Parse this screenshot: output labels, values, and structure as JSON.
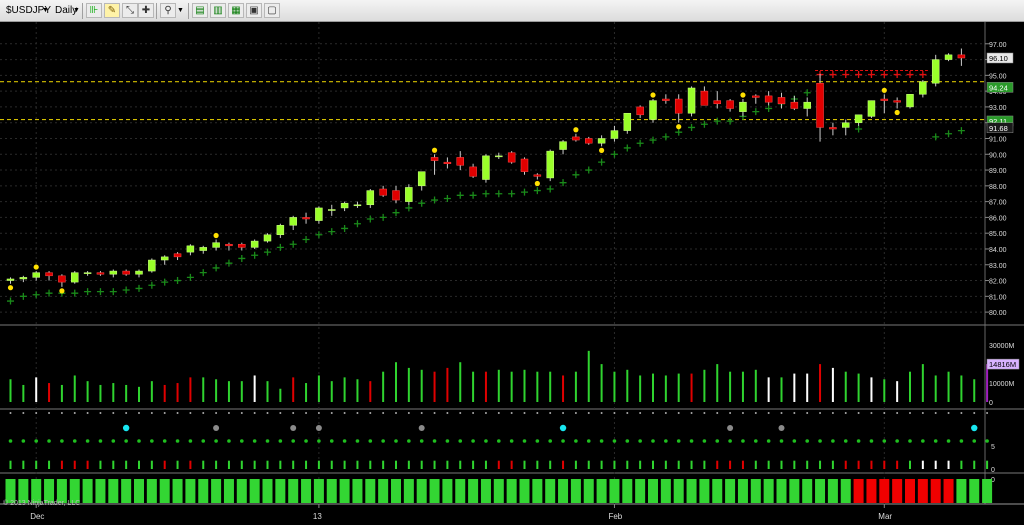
{
  "toolbar": {
    "instrument": "$USDJPY",
    "period": "Daily",
    "icons": [
      "bar-style-icon",
      "draw-pencil-icon",
      "draw-tools-icon",
      "crosshair-icon",
      "zoom-icon",
      "properties-icon",
      "indicators-icon",
      "strategies-icon",
      "templates-icon",
      "data-box-icon"
    ]
  },
  "copyright": "© 2013 NinjaTrader, LLC",
  "colors": {
    "up": "#9aff2a",
    "down": "#e00000",
    "dots": "#00a000",
    "resistance": "#d4c000",
    "last_price": "#e8e8e8",
    "support_label": "#00cc00"
  },
  "chart_data": [
    {
      "type": "candlestick",
      "name": "price",
      "ylim": [
        79.5,
        98
      ],
      "y_ticks": [
        "97.00",
        "96.00",
        "95.00",
        "94.00",
        "93.00",
        "92.00",
        "91.00",
        "90.00",
        "89.00",
        "88.00",
        "87.00",
        "86.00",
        "85.00",
        "84.00",
        "83.00",
        "82.00",
        "81.00",
        "80.00"
      ],
      "x_labels": [
        "Dec",
        "13",
        "Feb",
        "Mar"
      ],
      "x_label_index": [
        2,
        24,
        47,
        68
      ],
      "price_labels": {
        "last": "96.10",
        "upper": "94.24",
        "mid": "92.11",
        "lower": "91.68"
      },
      "candles": [
        [
          82.0,
          82.2,
          81.8,
          82.1
        ],
        [
          82.1,
          82.3,
          81.9,
          82.2
        ],
        [
          82.2,
          82.6,
          82.0,
          82.5
        ],
        [
          82.5,
          82.6,
          82.0,
          82.3
        ],
        [
          82.3,
          82.4,
          81.6,
          81.9
        ],
        [
          81.9,
          82.6,
          81.8,
          82.5
        ],
        [
          82.5,
          82.6,
          82.3,
          82.5
        ],
        [
          82.5,
          82.6,
          82.3,
          82.4
        ],
        [
          82.4,
          82.7,
          82.2,
          82.6
        ],
        [
          82.6,
          82.7,
          82.3,
          82.4
        ],
        [
          82.4,
          82.7,
          82.2,
          82.6
        ],
        [
          82.6,
          83.4,
          82.5,
          83.3
        ],
        [
          83.3,
          83.6,
          83.0,
          83.5
        ],
        [
          83.7,
          83.8,
          83.3,
          83.5
        ],
        [
          83.8,
          84.3,
          83.6,
          84.2
        ],
        [
          83.9,
          84.2,
          83.7,
          84.1
        ],
        [
          84.1,
          84.6,
          83.9,
          84.4
        ],
        [
          84.3,
          84.4,
          83.9,
          84.2
        ],
        [
          84.3,
          84.4,
          83.9,
          84.1
        ],
        [
          84.1,
          84.6,
          84.0,
          84.5
        ],
        [
          84.5,
          85.0,
          84.4,
          84.9
        ],
        [
          84.9,
          85.6,
          84.7,
          85.5
        ],
        [
          85.5,
          86.1,
          85.2,
          86.0
        ],
        [
          86.0,
          86.3,
          85.6,
          85.9
        ],
        [
          85.8,
          86.7,
          85.6,
          86.6
        ],
        [
          86.5,
          86.8,
          86.1,
          86.5
        ],
        [
          86.6,
          87.0,
          86.4,
          86.9
        ],
        [
          86.8,
          87.0,
          86.6,
          86.8
        ],
        [
          86.8,
          87.8,
          86.6,
          87.7
        ],
        [
          87.8,
          88.0,
          87.3,
          87.4
        ],
        [
          87.7,
          88.0,
          86.9,
          87.1
        ],
        [
          87.0,
          88.1,
          86.8,
          87.9
        ],
        [
          88.0,
          88.4,
          87.7,
          88.9
        ],
        [
          89.8,
          90.0,
          88.7,
          89.6
        ],
        [
          89.5,
          89.8,
          89.1,
          89.4
        ],
        [
          89.8,
          90.2,
          89.0,
          89.3
        ],
        [
          89.2,
          89.4,
          88.5,
          88.6
        ],
        [
          88.4,
          90.0,
          88.2,
          89.9
        ],
        [
          89.9,
          90.1,
          89.7,
          89.9
        ],
        [
          90.1,
          90.2,
          89.4,
          89.5
        ],
        [
          89.7,
          89.8,
          88.7,
          88.9
        ],
        [
          88.7,
          88.8,
          88.4,
          88.6
        ],
        [
          88.5,
          90.3,
          88.3,
          90.2
        ],
        [
          90.3,
          90.9,
          90.0,
          90.8
        ],
        [
          91.1,
          91.3,
          90.8,
          90.9
        ],
        [
          91.0,
          91.1,
          90.6,
          90.7
        ],
        [
          90.7,
          91.2,
          90.5,
          91.0
        ],
        [
          91.0,
          91.8,
          90.8,
          91.5
        ],
        [
          91.5,
          92.6,
          91.3,
          92.6
        ],
        [
          93.0,
          93.1,
          92.3,
          92.5
        ],
        [
          92.2,
          93.5,
          92.0,
          93.4
        ],
        [
          93.5,
          93.8,
          93.2,
          93.4
        ],
        [
          93.5,
          93.8,
          92.0,
          92.6
        ],
        [
          92.6,
          94.3,
          92.4,
          94.2
        ],
        [
          94.0,
          94.3,
          93.1,
          93.1
        ],
        [
          93.4,
          94.0,
          92.9,
          93.2
        ],
        [
          93.4,
          93.5,
          92.7,
          92.9
        ],
        [
          92.7,
          93.5,
          92.4,
          93.3
        ],
        [
          93.7,
          93.8,
          93.2,
          93.6
        ],
        [
          93.7,
          94.0,
          93.1,
          93.3
        ],
        [
          93.6,
          93.9,
          92.9,
          93.2
        ],
        [
          93.3,
          93.7,
          92.8,
          92.9
        ],
        [
          92.9,
          93.6,
          92.4,
          93.3
        ],
        [
          94.5,
          95.1,
          90.8,
          91.7
        ],
        [
          91.7,
          92.0,
          91.2,
          91.6
        ],
        [
          91.7,
          92.2,
          91.2,
          92.0
        ],
        [
          92.0,
          92.5,
          91.8,
          92.5
        ],
        [
          92.4,
          93.4,
          92.3,
          93.4
        ],
        [
          93.5,
          93.8,
          92.6,
          93.4
        ],
        [
          93.4,
          93.6,
          92.9,
          93.3
        ],
        [
          93.0,
          93.8,
          92.9,
          93.8
        ],
        [
          93.8,
          94.7,
          93.6,
          94.6
        ],
        [
          94.5,
          96.3,
          94.3,
          96.0
        ],
        [
          96.0,
          96.4,
          95.9,
          96.3
        ],
        [
          96.3,
          96.7,
          95.6,
          96.1
        ]
      ],
      "stop_dots": [
        80.7,
        81.0,
        81.1,
        81.2,
        81.2,
        81.2,
        81.3,
        81.3,
        81.3,
        81.4,
        81.5,
        81.7,
        81.9,
        82.0,
        82.2,
        82.5,
        82.8,
        83.1,
        83.4,
        83.6,
        83.8,
        84.1,
        84.3,
        84.6,
        84.9,
        85.1,
        85.3,
        85.6,
        85.9,
        86.0,
        86.3,
        86.6,
        86.9,
        87.1,
        87.2,
        87.4,
        87.4,
        87.5,
        87.5,
        87.5,
        87.6,
        87.7,
        87.8,
        88.2,
        88.7,
        89.0,
        89.5,
        90.0,
        90.4,
        90.7,
        90.9,
        91.1,
        91.4,
        91.7,
        91.9,
        92.1,
        92.1,
        92.4,
        92.7,
        92.9,
        93.2,
        93.5,
        93.9
      ],
      "resistance_levels": [
        94.6,
        92.2
      ],
      "red_stops": {
        "from_index": 63,
        "to_index": 71,
        "level": 95.05
      },
      "lower_green_dots": [
        {
          "i": 63,
          "v": 93.6
        },
        {
          "i": 66,
          "v": 91.6
        },
        {
          "i": 72,
          "v": 91.1
        },
        {
          "i": 73,
          "v": 91.3
        },
        {
          "i": 74,
          "v": 91.5
        }
      ],
      "yellow_markers": [
        {
          "i": 0,
          "v": 81.6,
          "pos": "low"
        },
        {
          "i": 2,
          "v": 82.8,
          "pos": "high"
        },
        {
          "i": 4,
          "v": 81.6,
          "pos": "low"
        },
        {
          "i": 16,
          "v": 84.7,
          "pos": "high"
        },
        {
          "i": 33,
          "v": 90.0,
          "pos": "high"
        },
        {
          "i": 41,
          "v": 88.2,
          "pos": "low"
        },
        {
          "i": 44,
          "v": 91.4,
          "pos": "high"
        },
        {
          "i": 46,
          "v": 90.3,
          "pos": "low"
        },
        {
          "i": 50,
          "v": 94.2,
          "pos": "high"
        },
        {
          "i": 52,
          "v": 91.8,
          "pos": "low"
        },
        {
          "i": 57,
          "v": 94.4,
          "pos": "high"
        },
        {
          "i": 68,
          "v": 93.6,
          "pos": "high"
        },
        {
          "i": 69,
          "v": 92.6,
          "pos": "low"
        }
      ]
    },
    {
      "type": "bar",
      "name": "volume",
      "ylim": [
        0,
        38000
      ],
      "y_ticks": [
        "30000M",
        "20000M",
        "10000M",
        "0"
      ],
      "last_value_label": "14816M",
      "values": [
        12000,
        9000,
        13000,
        10000,
        9000,
        14000,
        11000,
        9000,
        10000,
        9000,
        8000,
        11000,
        9000,
        10000,
        13000,
        13000,
        12000,
        11000,
        11000,
        14000,
        11000,
        7000,
        13000,
        10000,
        14000,
        11000,
        13000,
        12000,
        11000,
        16000,
        21000,
        18000,
        17000,
        16000,
        18000,
        21000,
        16000,
        16000,
        17000,
        16000,
        17000,
        16000,
        16000,
        14000,
        16000,
        27000,
        20000,
        16000,
        17000,
        14000,
        15000,
        14000,
        15000,
        15000,
        17000,
        20000,
        16000,
        16000,
        17000,
        13000,
        13000,
        15000,
        15000,
        20000,
        18000,
        16000,
        15000,
        13000,
        12000,
        11000,
        16000,
        20000,
        14000,
        16000,
        14000,
        12000,
        20000
      ],
      "colors": [
        "g",
        "g",
        "w",
        "r",
        "g",
        "g",
        "g",
        "g",
        "g",
        "g",
        "g",
        "g",
        "r",
        "r",
        "r",
        "g",
        "g",
        "g",
        "g",
        "w",
        "g",
        "g",
        "r",
        "g",
        "g",
        "g",
        "g",
        "g",
        "r",
        "g",
        "g",
        "g",
        "g",
        "r",
        "r",
        "g",
        "g",
        "r",
        "g",
        "g",
        "g",
        "g",
        "g",
        "r",
        "g",
        "g",
        "g",
        "g",
        "g",
        "g",
        "g",
        "g",
        "g",
        "r",
        "g",
        "g",
        "g",
        "g",
        "g",
        "w",
        "g",
        "w",
        "w",
        "r",
        "w",
        "g",
        "g",
        "w",
        "g",
        "w",
        "g",
        "g",
        "g",
        "g",
        "g",
        "g",
        "p"
      ]
    },
    {
      "type": "dot_matrix",
      "name": "indicator_dots",
      "cyan_index": [
        9,
        43,
        75
      ],
      "gray_index": [
        16,
        22,
        24,
        32,
        56,
        60
      ]
    },
    {
      "type": "bar",
      "name": "oscillator",
      "ylim": [
        0,
        8
      ],
      "y_ticks": [
        "5",
        "0"
      ],
      "colors": [
        "g",
        "g",
        "g",
        "g",
        "r",
        "r",
        "r",
        "g",
        "g",
        "g",
        "g",
        "g",
        "r",
        "g",
        "r",
        "g",
        "g",
        "g",
        "g",
        "g",
        "g",
        "g",
        "g",
        "g",
        "g",
        "g",
        "g",
        "g",
        "g",
        "g",
        "g",
        "g",
        "g",
        "g",
        "g",
        "g",
        "g",
        "g",
        "r",
        "r",
        "g",
        "g",
        "g",
        "r",
        "g",
        "g",
        "g",
        "g",
        "g",
        "g",
        "g",
        "g",
        "g",
        "g",
        "g",
        "r",
        "r",
        "r",
        "g",
        "g",
        "g",
        "g",
        "g",
        "g",
        "g",
        "r",
        "r",
        "r",
        "r",
        "r",
        "g",
        "w",
        "w",
        "w",
        "g",
        "g",
        "g"
      ]
    },
    {
      "type": "bar",
      "name": "trend_histogram",
      "ylim": [
        0,
        1
      ],
      "y_ticks": [
        "0"
      ],
      "colors": [
        "g",
        "g",
        "g",
        "g",
        "g",
        "g",
        "g",
        "g",
        "g",
        "g",
        "g",
        "g",
        "g",
        "g",
        "g",
        "g",
        "g",
        "g",
        "g",
        "g",
        "g",
        "g",
        "g",
        "g",
        "g",
        "g",
        "g",
        "g",
        "g",
        "g",
        "g",
        "g",
        "g",
        "g",
        "g",
        "g",
        "g",
        "g",
        "g",
        "g",
        "g",
        "g",
        "g",
        "g",
        "g",
        "g",
        "g",
        "g",
        "g",
        "g",
        "g",
        "g",
        "g",
        "g",
        "g",
        "g",
        "g",
        "g",
        "g",
        "g",
        "g",
        "g",
        "g",
        "g",
        "g",
        "g",
        "r",
        "r",
        "r",
        "r",
        "r",
        "r",
        "r",
        "r",
        "g",
        "g",
        "g"
      ]
    }
  ]
}
